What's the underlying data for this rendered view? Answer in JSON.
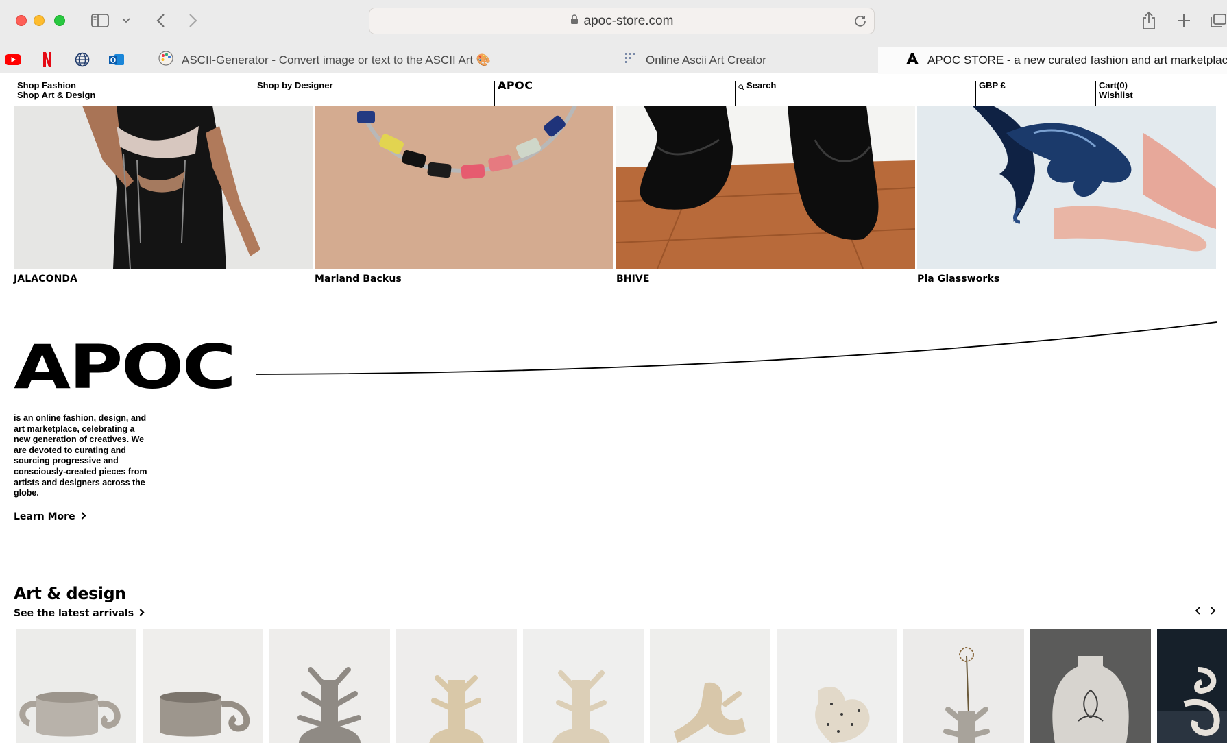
{
  "browser": {
    "url": "apoc-store.com",
    "tabs": [
      {
        "title": "ASCII-Generator - Convert image or text to the ASCII Art 🎨"
      },
      {
        "title": "Online Ascii Art Creator"
      },
      {
        "title": "APOC STORE - a new curated fashion and art marketplace"
      }
    ],
    "favorites": [
      "youtube-icon",
      "netflix-icon",
      "globe-icon",
      "outlook-icon"
    ]
  },
  "nav": {
    "shop_fashion": "Shop Fashion",
    "shop_art": "Shop Art & Design",
    "shop_designer": "Shop by Designer",
    "logo": "APOC",
    "search": "Search",
    "currency": "GBP £",
    "cart": "Cart(0)",
    "wishlist": "Wishlist"
  },
  "designers": [
    {
      "name": "JALACONDA"
    },
    {
      "name": "Marland Backus"
    },
    {
      "name": "BHIVE"
    },
    {
      "name": "Pia Glassworks"
    }
  ],
  "about": {
    "heading": "APOC",
    "text": "is an online fashion, design, and art marketplace, celebrating a new generation of creatives. We are devoted to curating and sourcing progressive and consciously-created pieces from artists and designers across the globe.",
    "cta": "Learn More"
  },
  "art_design": {
    "title": "Art & design",
    "subtitle": "See the latest arrivals",
    "products": [
      "mug",
      "mug",
      "vase-spiked",
      "vase-cream",
      "vase-cream-2",
      "sculpture",
      "sculpture-speckled",
      "vase-flower",
      "vase-dark",
      "sculpture-swirl"
    ]
  },
  "colors": {
    "accent": "#000000",
    "chrome_bg": "#ebebeb",
    "close": "#fe5f57",
    "minimize": "#febc2e",
    "zoom": "#28c840"
  }
}
